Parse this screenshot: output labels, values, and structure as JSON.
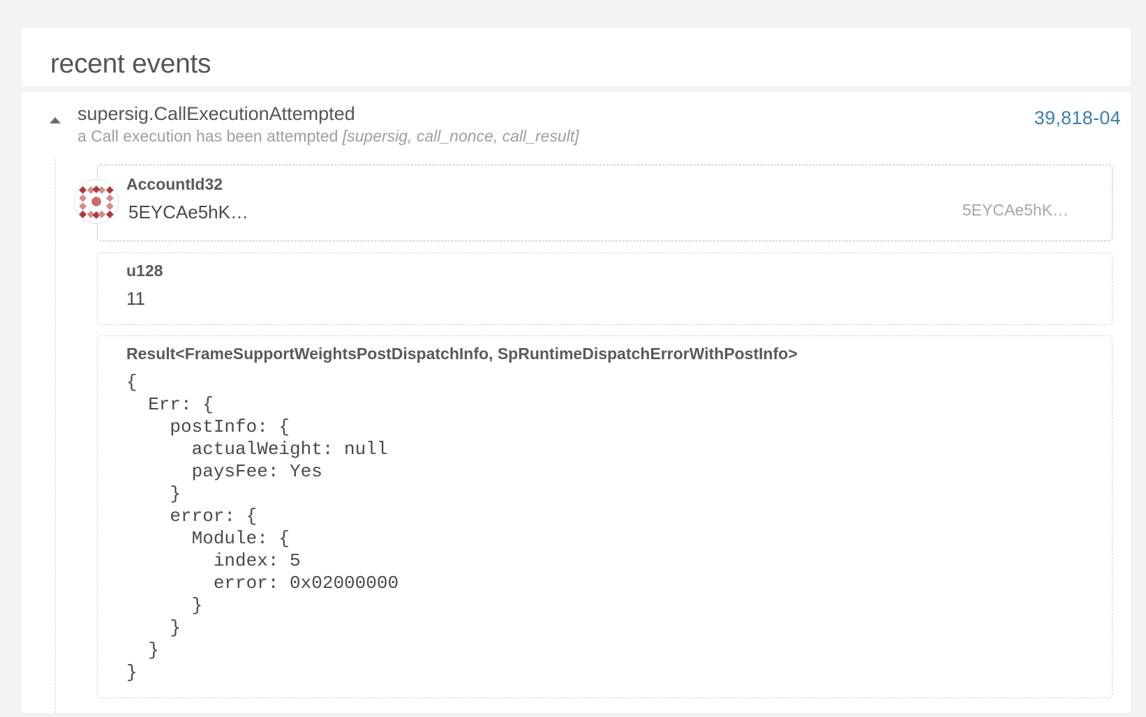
{
  "header": {
    "title": "recent events"
  },
  "event": {
    "name": "supersig.CallExecutionAttempted",
    "description": "a Call execution has been attempted",
    "fields": "[supersig, call_nonce, call_result]",
    "block_link": "39,818-04",
    "params": [
      {
        "type": "AccountId32",
        "value": "5EYCAe5hK…",
        "address_short": "5EYCAe5hK…"
      },
      {
        "type": "u128",
        "value": "11"
      },
      {
        "type": "Result<FrameSupportWeightsPostDispatchInfo, SpRuntimeDispatchErrorWithPostInfo>",
        "value": "{\n  Err: {\n    postInfo: {\n      actualWeight: null\n      paysFee: Yes\n    }\n    error: {\n      Module: {\n        index: 5\n        error: 0x02000000\n      }\n    }\n  }\n}"
      }
    ]
  },
  "icons": {
    "toggle": "caret-up-icon",
    "avatar": "identicon-icon"
  },
  "colors": {
    "accent_link": "#3f7fa8",
    "identicon_dark": "#a83a44",
    "identicon_light": "#d98a8a"
  }
}
